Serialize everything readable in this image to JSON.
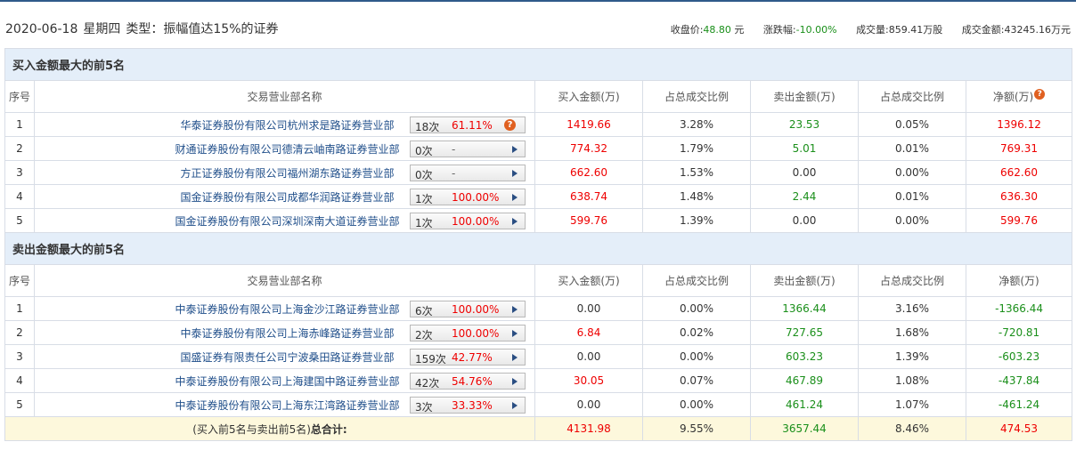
{
  "header": {
    "date": "2020-06-18",
    "weekday": "星期四",
    "type_text": "类型：振幅值达15%的证券",
    "close_label": "收盘价:",
    "close_value": "48.80",
    "close_unit": "元",
    "change_label": "涨跌幅:",
    "change_value": "-10.00%",
    "volume_label": "成交量:",
    "volume_value": "859.41万股",
    "amount_label": "成交金额:",
    "amount_value": "43245.16万元"
  },
  "columns": {
    "idx": "序号",
    "name": "交易营业部名称",
    "buy": "买入金额(万)",
    "buy_ratio": "占总成交比例",
    "sell": "卖出金额(万)",
    "sell_ratio": "占总成交比例",
    "net": "净额(万)"
  },
  "help_glyph": "?",
  "buy_section": {
    "title": "买入金额最大的前5名",
    "rows": [
      {
        "idx": "1",
        "name": "华泰证券股份有限公司杭州求是路证券营业部",
        "count": "18次",
        "rate": "61.11%",
        "buy": "1419.66",
        "buy_ratio": "3.28%",
        "sell": "23.53",
        "sell_ratio": "0.05%",
        "net": "1396.12",
        "help": true
      },
      {
        "idx": "2",
        "name": "财通证券股份有限公司德清云岫南路证券营业部",
        "count": "0次",
        "rate": "-",
        "buy": "774.32",
        "buy_ratio": "1.79%",
        "sell": "5.01",
        "sell_ratio": "0.01%",
        "net": "769.31"
      },
      {
        "idx": "3",
        "name": "方正证券股份有限公司福州湖东路证券营业部",
        "count": "0次",
        "rate": "-",
        "buy": "662.60",
        "buy_ratio": "1.53%",
        "sell": "0.00",
        "sell_ratio": "0.00%",
        "net": "662.60"
      },
      {
        "idx": "4",
        "name": "国金证券股份有限公司成都华润路证券营业部",
        "count": "1次",
        "rate": "100.00%",
        "buy": "638.74",
        "buy_ratio": "1.48%",
        "sell": "2.44",
        "sell_ratio": "0.01%",
        "net": "636.30"
      },
      {
        "idx": "5",
        "name": "国金证券股份有限公司深圳深南大道证券营业部",
        "count": "1次",
        "rate": "100.00%",
        "buy": "599.76",
        "buy_ratio": "1.39%",
        "sell": "0.00",
        "sell_ratio": "0.00%",
        "net": "599.76"
      }
    ]
  },
  "sell_section": {
    "title": "卖出金额最大的前5名",
    "rows": [
      {
        "idx": "1",
        "name": "中泰证券股份有限公司上海金沙江路证券营业部",
        "count": "6次",
        "rate": "100.00%",
        "buy": "0.00",
        "buy_ratio": "0.00%",
        "sell": "1366.44",
        "sell_ratio": "3.16%",
        "net": "-1366.44"
      },
      {
        "idx": "2",
        "name": "中泰证券股份有限公司上海赤峰路证券营业部",
        "count": "2次",
        "rate": "100.00%",
        "buy": "6.84",
        "buy_ratio": "0.02%",
        "sell": "727.65",
        "sell_ratio": "1.68%",
        "net": "-720.81"
      },
      {
        "idx": "3",
        "name": "国盛证券有限责任公司宁波桑田路证券营业部",
        "count": "159次",
        "rate": "42.77%",
        "buy": "0.00",
        "buy_ratio": "0.00%",
        "sell": "603.23",
        "sell_ratio": "1.39%",
        "net": "-603.23"
      },
      {
        "idx": "4",
        "name": "中泰证券股份有限公司上海建国中路证券营业部",
        "count": "42次",
        "rate": "54.76%",
        "buy": "30.05",
        "buy_ratio": "0.07%",
        "sell": "467.89",
        "sell_ratio": "1.08%",
        "net": "-437.84"
      },
      {
        "idx": "5",
        "name": "中泰证券股份有限公司上海东江湾路证券营业部",
        "count": "3次",
        "rate": "33.33%",
        "buy": "0.00",
        "buy_ratio": "0.00%",
        "sell": "461.24",
        "sell_ratio": "1.07%",
        "net": "-461.24"
      }
    ]
  },
  "total": {
    "label_prefix": "(买入前5名与卖出前5名)",
    "label_bold": "总合计:",
    "buy": "4131.98",
    "buy_ratio": "9.55%",
    "sell": "3657.44",
    "sell_ratio": "8.46%",
    "net": "474.53"
  },
  "colors": {
    "accent": "#2f5a8a",
    "red": "#e00000",
    "green": "#1a8f1a",
    "section_bg": "#e4eef9",
    "total_bg": "#fdf8dc"
  }
}
